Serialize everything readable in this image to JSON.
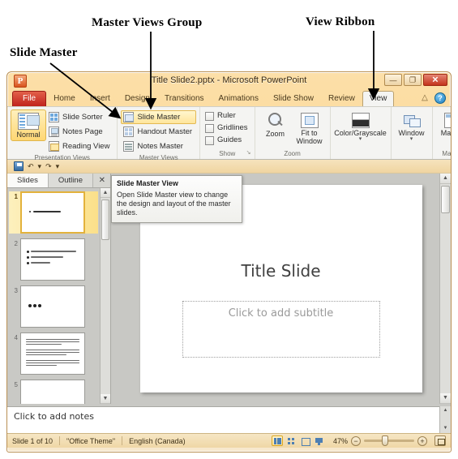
{
  "annotations": [
    {
      "id": "slide-master",
      "label": "Slide Master"
    },
    {
      "id": "master-views",
      "label": "Master Views Group"
    },
    {
      "id": "view-ribbon",
      "label": "View Ribbon"
    }
  ],
  "window": {
    "title": "Title Slide2.pptx  -  Microsoft PowerPoint",
    "app_logo": "P",
    "controls": {
      "minimize": "—",
      "maximize": "❐",
      "close": "✕"
    }
  },
  "tabs": [
    {
      "label": "File",
      "active": false,
      "kind": "file"
    },
    {
      "label": "Home",
      "active": false
    },
    {
      "label": "Insert",
      "active": false
    },
    {
      "label": "Design",
      "active": false
    },
    {
      "label": "Transitions",
      "active": false
    },
    {
      "label": "Animations",
      "active": false
    },
    {
      "label": "Slide Show",
      "active": false
    },
    {
      "label": "Review",
      "active": false
    },
    {
      "label": "View",
      "active": true
    }
  ],
  "tabstrip_right": {
    "collapse_ribbon": "△",
    "help": "?"
  },
  "ribbon": {
    "groups": [
      {
        "name": "Presentation Views",
        "label": "Presentation Views",
        "big_button": {
          "label": "Normal",
          "selected": true,
          "icon": "normal-view-icon"
        },
        "items": [
          {
            "label": "Slide Sorter",
            "icon": "slide-sorter-icon"
          },
          {
            "label": "Notes Page",
            "icon": "notes-page-icon"
          },
          {
            "label": "Reading View",
            "icon": "reading-view-icon"
          }
        ]
      },
      {
        "name": "Master Views",
        "label": "Master Views",
        "items": [
          {
            "label": "Slide Master",
            "icon": "slide-master-icon",
            "hover": true
          },
          {
            "label": "Handout Master",
            "icon": "handout-master-icon"
          },
          {
            "label": "Notes Master",
            "icon": "notes-master-icon"
          }
        ]
      },
      {
        "name": "Show",
        "label": "Show",
        "dialog_launcher": "↘",
        "items": [
          {
            "label": "Ruler",
            "checked": false
          },
          {
            "label": "Gridlines",
            "checked": false
          },
          {
            "label": "Guides",
            "checked": false
          }
        ]
      },
      {
        "name": "Zoom",
        "label": "Zoom",
        "items": [
          {
            "label": "Zoom",
            "icon": "magnifier-icon"
          },
          {
            "label": "Fit to Window",
            "icon": "fit-to-window-icon"
          }
        ]
      },
      {
        "name": "Color",
        "label": "",
        "items": [
          {
            "label": "Color/Grayscale",
            "icon": "color-grayscale-icon",
            "caret": "▾"
          }
        ]
      },
      {
        "name": "Window",
        "label": "",
        "items": [
          {
            "label": "Window",
            "icon": "window-icon",
            "caret": "▾"
          }
        ]
      },
      {
        "name": "Macros",
        "label": "Macros",
        "items": [
          {
            "label": "Macros",
            "icon": "macros-icon"
          }
        ]
      }
    ]
  },
  "quick_access": {
    "save": "save-icon",
    "undo": "↶",
    "undo_caret": "▾",
    "redo": "↷",
    "customize": "▾"
  },
  "panel": {
    "tabs": [
      {
        "label": "Slides",
        "active": true
      },
      {
        "label": "Outline",
        "active": false
      }
    ],
    "close": "✕",
    "thumbnails": [
      {
        "number": "1",
        "selected": true,
        "kind": "title"
      },
      {
        "number": "2",
        "selected": false,
        "kind": "bullets"
      },
      {
        "number": "3",
        "selected": false,
        "kind": "dots"
      },
      {
        "number": "4",
        "selected": false,
        "kind": "paragraphs"
      },
      {
        "number": "5",
        "selected": false,
        "kind": "blank"
      }
    ]
  },
  "slide": {
    "title": "Title Slide",
    "subtitle_placeholder": "Click to add subtitle"
  },
  "tooltip": {
    "title": "Slide Master View",
    "body": "Open Slide Master view to change the design and layout of the master slides."
  },
  "notes": {
    "placeholder": "Click to add notes"
  },
  "statusbar": {
    "slide_count": "Slide 1 of 10",
    "theme": "\"Office Theme\"",
    "language": "English (Canada)",
    "view_buttons": [
      {
        "name": "normal-view",
        "active": true
      },
      {
        "name": "slide-sorter-view",
        "active": false
      },
      {
        "name": "reading-view",
        "active": false
      },
      {
        "name": "slide-show-view",
        "active": false
      }
    ],
    "zoom_level": "47%",
    "zoom_out": "−",
    "zoom_in": "+",
    "fit_to_window": "fit-slide-icon"
  },
  "colors": {
    "accent": "#e3b23c",
    "file_tab": "#c0231c",
    "close_button": "#c3331c",
    "window_chrome": "#fbd692"
  }
}
